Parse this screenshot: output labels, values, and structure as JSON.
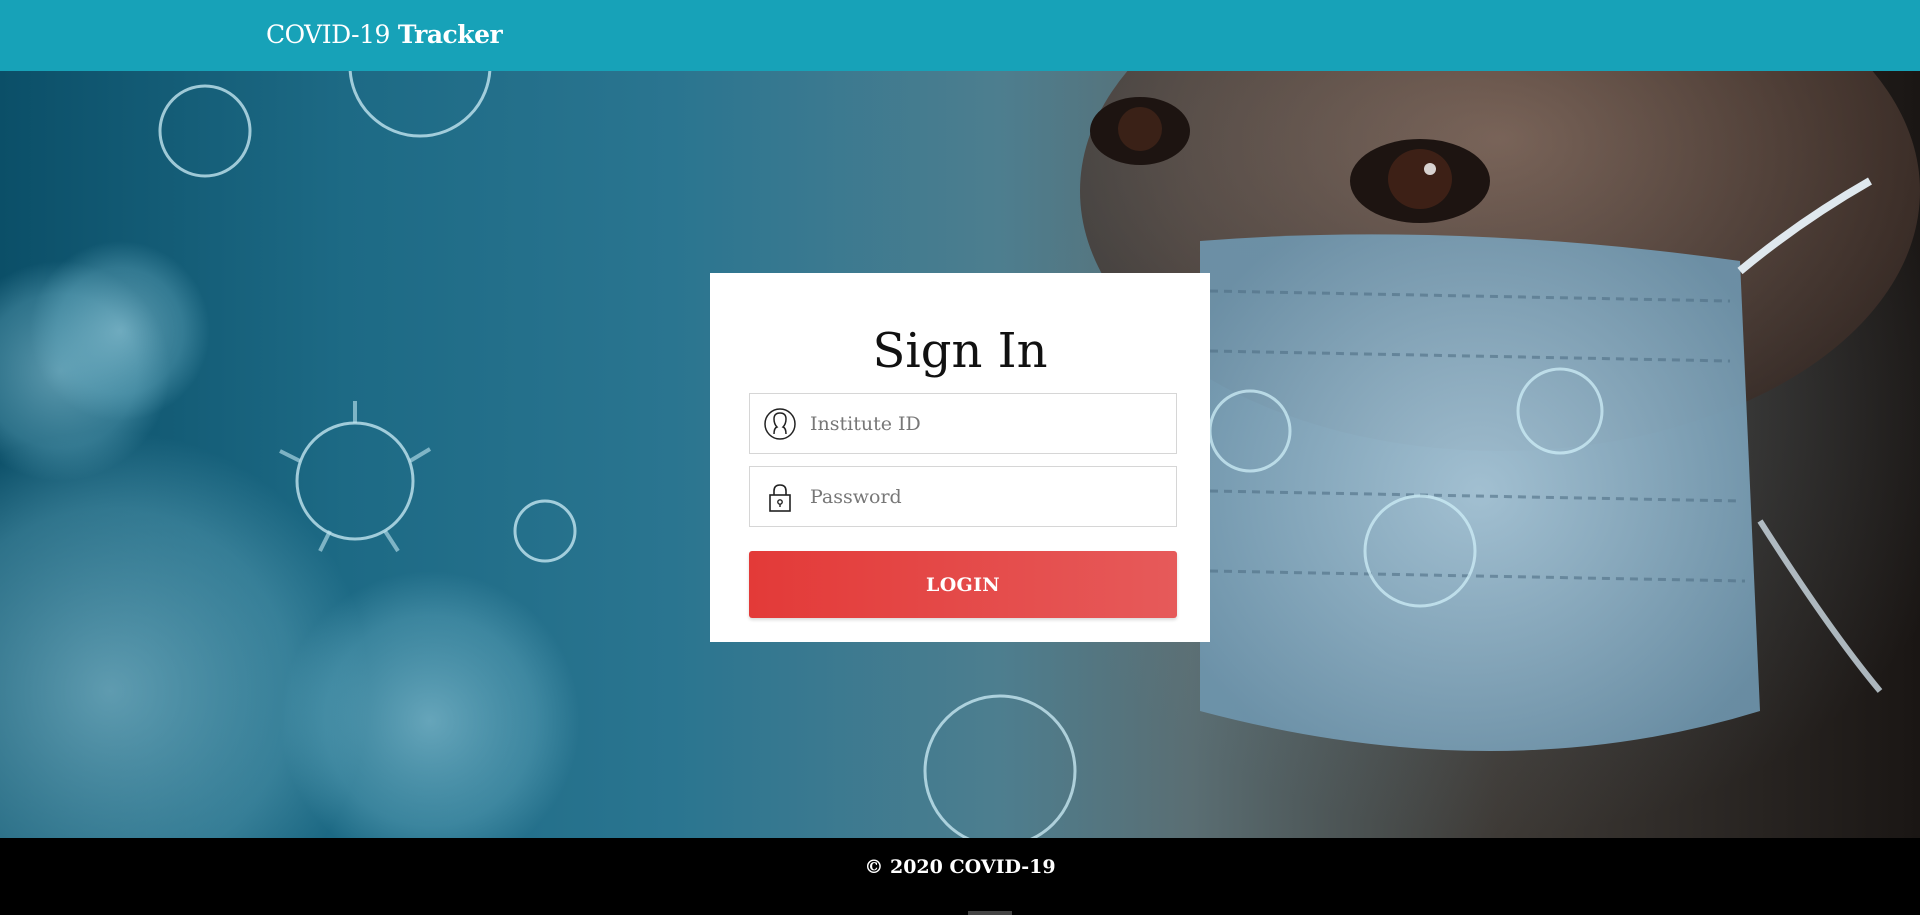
{
  "navbar": {
    "brand_light": "COVID-19",
    "brand_bold": "Tracker"
  },
  "signin": {
    "title": "Sign In",
    "institute_id_placeholder": "Institute ID",
    "password_placeholder": "Password",
    "login_label": "LOGIN"
  },
  "footer": {
    "text": "© 2020 COVID-19"
  },
  "icons": {
    "user": "user-icon",
    "lock": "lock-icon"
  },
  "colors": {
    "navbar": "#17a2b8",
    "login_button": "#e33a38",
    "footer": "#000000",
    "card": "#ffffff"
  }
}
